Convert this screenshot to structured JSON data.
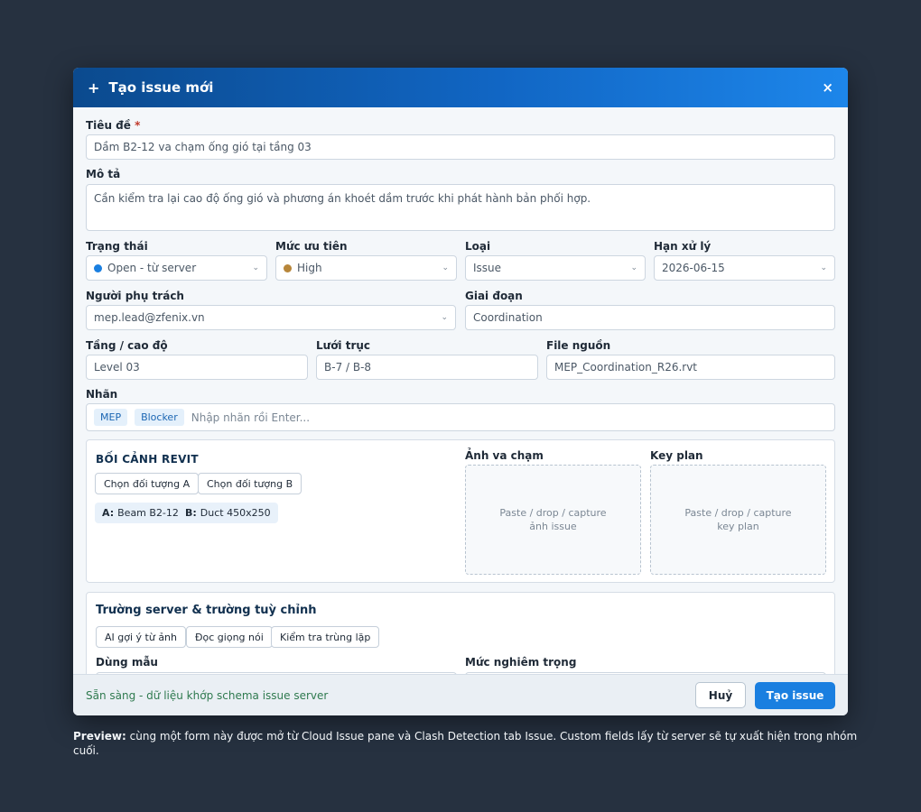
{
  "dialog": {
    "title": "Tạo issue mới",
    "plus_glyph": "+",
    "close_glyph": "×"
  },
  "form": {
    "title_label": "Tiêu đề",
    "title_required_mark": "*",
    "title_value": "Dầm B2-12 va chạm ống gió tại tầng 03",
    "description_label": "Mô tả",
    "description_value": "Cần kiểm tra lại cao độ ống gió và phương án khoét dầm trước khi phát hành bản phối hợp.",
    "status_label": "Trạng thái",
    "status_value": "Open - từ server",
    "status_color": "#1a7fe0",
    "priority_label": "Mức ưu tiên",
    "priority_value": "High",
    "priority_color": "#b7863a",
    "type_label": "Loại",
    "type_value": "Issue",
    "due_label": "Hạn xử lý",
    "due_value": "2026-06-15",
    "assignee_label": "Người phụ trách",
    "assignee_value": "mep.lead@zfenix.vn",
    "phase_label": "Giai đoạn",
    "phase_value": "Coordination",
    "level_label": "Tầng / cao độ",
    "level_value": "Level 03",
    "grid_label": "Lưới trục",
    "grid_value": "B-7 / B-8",
    "source_label": "File nguồn",
    "source_value": "MEP_Coordination_R26.rvt",
    "tags_label": "Nhãn",
    "tags": [
      "MEP",
      "Blocker"
    ],
    "tags_placeholder": "Nhập nhãn rồi Enter..."
  },
  "revit": {
    "title": "BỐI CẢNH REVIT",
    "pick_a": "Chọn đối tượng A",
    "pick_b": "Chọn đối tượng B",
    "obj_a_key": "A:",
    "obj_a_val": "Beam B2-12",
    "obj_b_key": "B:",
    "obj_b_val": "Duct 450x250",
    "clash_image_label": "Ảnh va chạm",
    "clash_image_hint_1": "Paste / drop / capture",
    "clash_image_hint_2": "ảnh issue",
    "keyplan_label": "Key plan",
    "keyplan_hint_1": "Paste / drop / capture",
    "keyplan_hint_2": "key plan"
  },
  "custom": {
    "title": "Trường server & trường tuỳ chỉnh",
    "ai_btn": "AI gợi ý từ ảnh",
    "voice_btn": "Đọc giọng nói",
    "dup_btn": "Kiểm tra trùng lặp",
    "template_label": "Dùng mẫu",
    "severity_label": "Mức nghiêm trọng"
  },
  "footer": {
    "status": "Sẵn sàng - dữ liệu khớp schema issue server",
    "cancel": "Huỷ",
    "submit": "Tạo issue"
  },
  "preview": {
    "prefix": "Preview:",
    "text": "cùng một form này được mở từ Cloud Issue pane và Clash Detection tab Issue. Custom fields lấy từ server sẽ tự xuất hiện trong nhóm cuối."
  }
}
